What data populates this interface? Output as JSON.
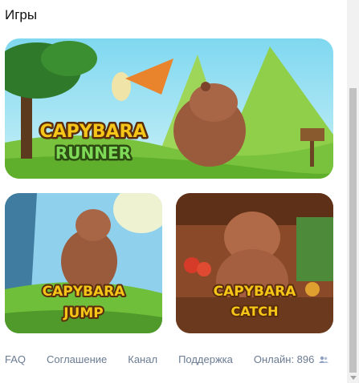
{
  "section": {
    "title": "Игры"
  },
  "games": [
    {
      "logo_line1": "CAPYBARA",
      "logo_line2": "RUNNER"
    },
    {
      "logo_line1": "CAPYBARA",
      "logo_line2": "JUMP"
    },
    {
      "logo_line1": "CAPYBARA",
      "logo_line2": "CATCH"
    }
  ],
  "footer": {
    "faq": "FAQ",
    "agreement": "Соглашение",
    "channel": "Канал",
    "support": "Поддержка",
    "online_label": "Онлайн: 896",
    "online_icon": "users-icon"
  },
  "colors": {
    "link": "#6a7b93",
    "logo_fill": "#f5c518",
    "logo_stroke": "#5a2d0c",
    "runner_green": "#2e7d32"
  }
}
